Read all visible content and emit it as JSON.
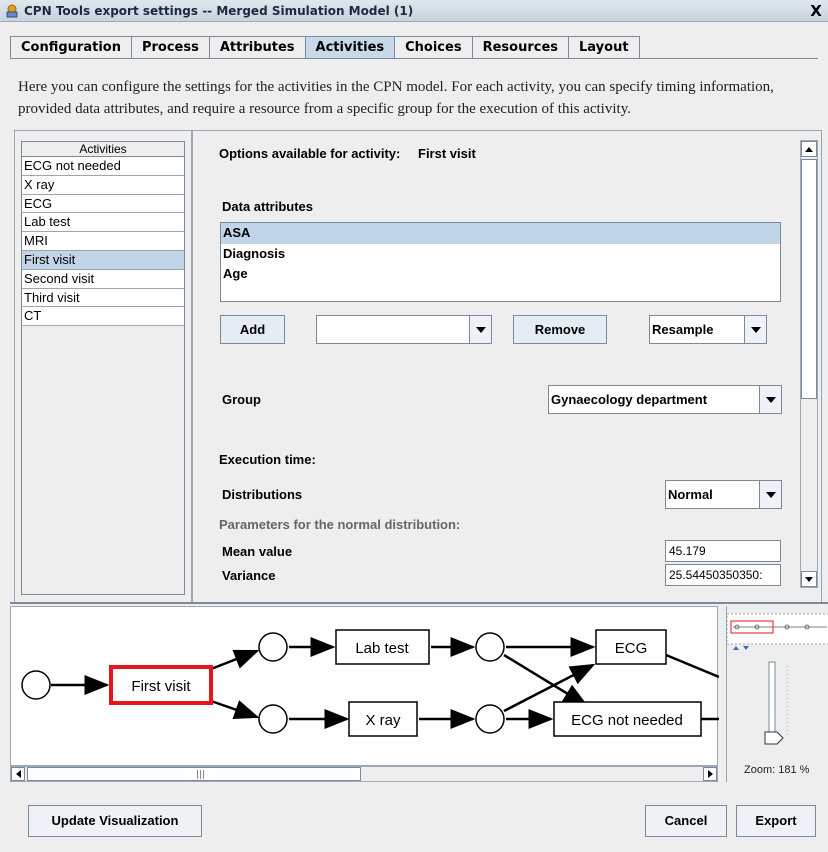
{
  "window": {
    "title": "CPN Tools export settings -- Merged Simulation Model (1)",
    "close_label": "X"
  },
  "tabs": [
    {
      "label": "Configuration"
    },
    {
      "label": "Process"
    },
    {
      "label": "Attributes"
    },
    {
      "label": "Activities"
    },
    {
      "label": "Choices"
    },
    {
      "label": "Resources"
    },
    {
      "label": "Layout"
    }
  ],
  "description": "Here you can configure the settings for the activities in the CPN model. For each activity, you can specify timing information, provided data attributes, and require a resource from a specific group for the execution of this activity.",
  "activities": {
    "header": "Activities",
    "items": [
      "ECG not needed",
      "X ray",
      "ECG",
      "Lab test",
      "MRI",
      "First visit",
      "Second visit",
      "Third visit",
      "CT"
    ],
    "selected": "First visit"
  },
  "options": {
    "heading_label": "Options available for activity:",
    "activity_name": "First visit",
    "data_attributes_label": "Data attributes",
    "attributes": [
      "ASA",
      "Diagnosis",
      "Age"
    ],
    "selected_attribute": "ASA",
    "add_label": "Add",
    "attribute_combo_value": "",
    "remove_label": "Remove",
    "resample_value": "Resample",
    "group_label": "Group",
    "group_value": "Gynaecology department",
    "execution_time_label": "Execution time:",
    "distributions_label": "Distributions",
    "distribution_value": "Normal",
    "parameters_label": "Parameters for the normal distribution:",
    "mean_label": "Mean value",
    "mean_value": "45.179",
    "variance_label": "Variance",
    "variance_value": "25.54450350350:"
  },
  "graph": {
    "transitions": [
      "First visit",
      "Lab test",
      "X ray",
      "ECG",
      "ECG not needed"
    ],
    "highlighted": "First visit"
  },
  "zoom_label": "Zoom: 181 %",
  "buttons": {
    "update_visualization": "Update Visualization",
    "cancel": "Cancel",
    "export": "Export"
  },
  "colors": {
    "selection": "#c2d4e8",
    "highlight_border": "#e8151b",
    "active_tab": "#c8d9ea"
  }
}
